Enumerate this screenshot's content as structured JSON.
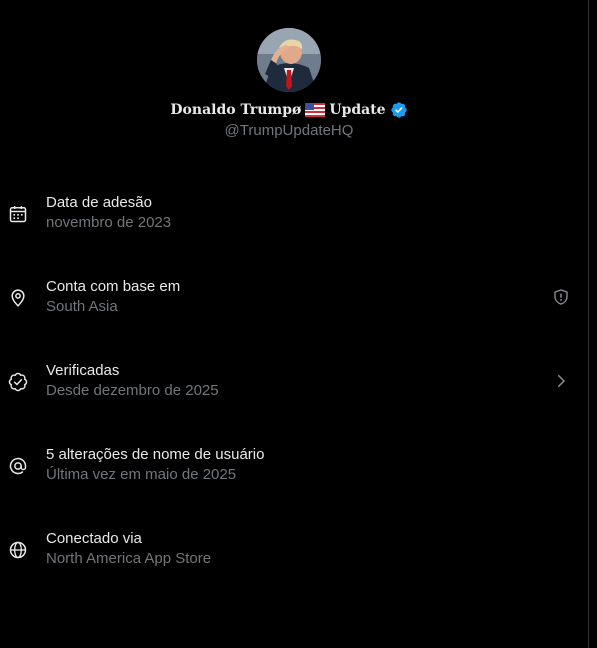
{
  "profile": {
    "display_name": "Donaldo Trumpø",
    "name_suffix": "Update",
    "handle": "@TrumpUpdateHQ",
    "verified_color": "#1d9bf0"
  },
  "info": [
    {
      "icon": "calendar-icon",
      "title": "Data de adesão",
      "subtitle": "novembro de 2023"
    },
    {
      "icon": "location-pin-icon",
      "title": "Conta com base em",
      "subtitle": "South Asia",
      "trailing": "shield-alert-icon"
    },
    {
      "icon": "verified-badge-outline-icon",
      "title": "Verificadas",
      "subtitle": "Desde dezembro de 2025",
      "trailing": "chevron-right-icon"
    },
    {
      "icon": "at-sign-icon",
      "title": "5 alterações de nome de usuário",
      "subtitle": "Última vez em maio de 2025"
    },
    {
      "icon": "globe-icon",
      "title": "Conectado via",
      "subtitle": "North America App Store"
    }
  ],
  "colors": {
    "background": "#000000",
    "primary_text": "#e7e9ea",
    "secondary_text": "#71767b",
    "border": "#2f3336"
  }
}
